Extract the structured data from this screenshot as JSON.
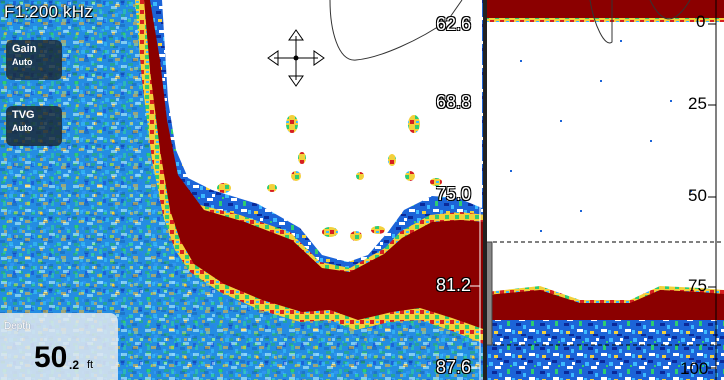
{
  "left_panel": {
    "frequency_label": "F1:200 kHz",
    "gain": {
      "title": "Gain",
      "value": "Auto"
    },
    "tvg": {
      "title": "TVG",
      "value": "Auto"
    },
    "depth_box": {
      "label": "Depth",
      "value": "50",
      "decimal": ".2",
      "unit": "ft"
    },
    "scale_labels": [
      "62.6",
      "68.8",
      "75.0",
      "81.2",
      "87.6"
    ],
    "pan_icon": "four-way-arrow-icon"
  },
  "right_panel": {
    "scale_labels": [
      "0",
      "25",
      "50",
      "75",
      "100"
    ]
  },
  "colors": {
    "bottom_echo": "#8b0000",
    "water_column": "#ffffff",
    "noise_dark": "#0a2a9a",
    "noise_light": "#3bb8ff",
    "noise_green": "#2ecc71",
    "noise_yellow": "#f3d03b",
    "noise_red": "#d62020"
  }
}
